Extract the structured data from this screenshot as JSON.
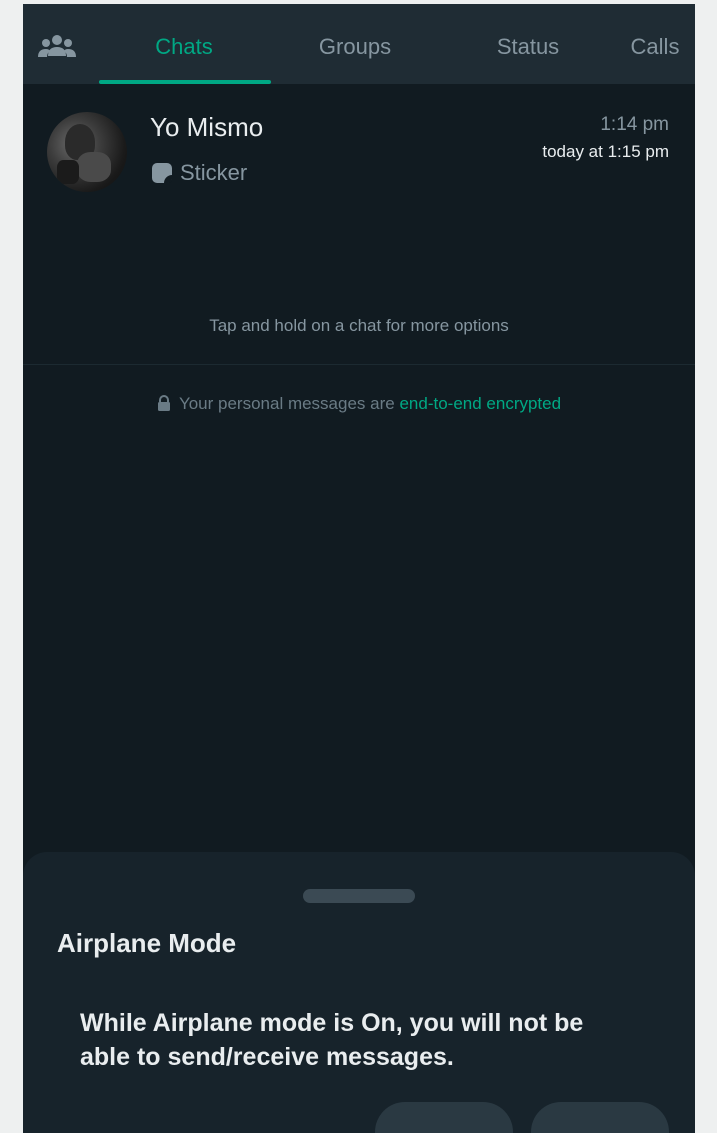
{
  "tabs": [
    {
      "label": "Chats",
      "active": true
    },
    {
      "label": "Groups",
      "active": false
    },
    {
      "label": "Status",
      "active": false
    },
    {
      "label": "Calls",
      "active": false
    }
  ],
  "chat": {
    "name": "Yo Mismo",
    "preview": "Sticker",
    "time": "1:14 pm",
    "subtime": "today at 1:15 pm"
  },
  "hint": "Tap and hold on a chat for more options",
  "encryption": {
    "prefix": "Your personal messages are ",
    "link": "end-to-end encrypted"
  },
  "sheet": {
    "title": "Airplane Mode",
    "message": "While Airplane mode is On, you will not be able to send/receive messages."
  },
  "colors": {
    "accent": "#00a884",
    "background": "#111b21",
    "bar": "#1f2c34"
  }
}
